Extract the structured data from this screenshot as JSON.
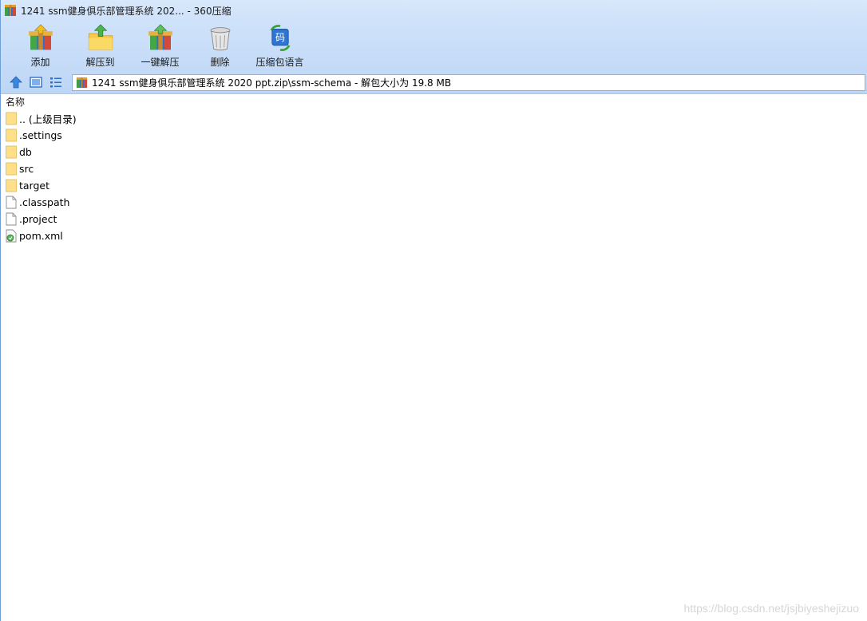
{
  "window": {
    "title": "1241 ssm健身俱乐部管理系统 202... - 360压缩",
    "app_icon": "archive-icon"
  },
  "toolbar": {
    "buttons": [
      {
        "label": "添加",
        "icon": "add-archive-icon"
      },
      {
        "label": "解压到",
        "icon": "extract-to-icon"
      },
      {
        "label": "一键解压",
        "icon": "one-click-extract-icon"
      },
      {
        "label": "删除",
        "icon": "trash-icon"
      },
      {
        "label": "压缩包语言",
        "icon": "archive-language-icon",
        "icon_text": "码"
      }
    ]
  },
  "nav": {
    "up_icon": "up-arrow-icon",
    "view_icon": "thumbnail-view-icon",
    "list_icon": "list-view-icon"
  },
  "address": {
    "path": "1241 ssm健身俱乐部管理系统 2020 ppt.zip\\ssm-schema - 解包大小为 19.8 MB"
  },
  "list": {
    "column_name": "名称",
    "items": [
      {
        "name": ".. (上级目录)",
        "type": "folder"
      },
      {
        "name": ".settings",
        "type": "folder"
      },
      {
        "name": "db",
        "type": "folder"
      },
      {
        "name": "src",
        "type": "folder"
      },
      {
        "name": "target",
        "type": "folder"
      },
      {
        "name": ".classpath",
        "type": "file"
      },
      {
        "name": ".project",
        "type": "file"
      },
      {
        "name": "pom.xml",
        "type": "xml"
      }
    ]
  },
  "watermark": "https://blog.csdn.net/jsjbiyeshejizuo",
  "colors": {
    "toolbar_bg": "#c3daf7",
    "folder": "#ffe08a",
    "address_border": "#8fb1de"
  }
}
